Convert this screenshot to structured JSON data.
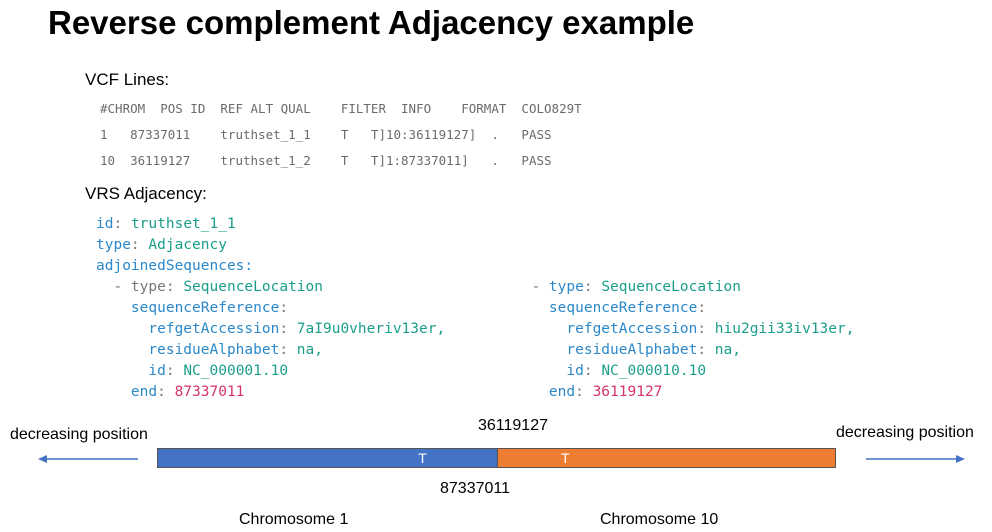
{
  "title": "Reverse complement Adjacency example",
  "vcf": {
    "heading": "VCF Lines:",
    "header": "#CHROM  POS ID  REF ALT QUAL    FILTER  INFO    FORMAT  COLO829T",
    "rows": [
      "1   87337011    truthset_1_1    T   T]10:36119127]  .   PASS",
      "10  36119127    truthset_1_2    T   T]1:87337011]   .   PASS"
    ]
  },
  "vrs": {
    "heading": "VRS Adjacency:",
    "id": "truthset_1_1",
    "type": "Adjacency",
    "adjoined_key": "adjoinedSequences:",
    "sequences": [
      {
        "type": "SequenceLocation",
        "refgetAccession": "7aI9u0vheriv13er,",
        "residueAlphabet": "na,",
        "id": "NC_000001.10",
        "end": "87337011"
      },
      {
        "type": "SequenceLocation",
        "refgetAccession": "hiu2gii33iv13er,",
        "residueAlphabet": "na,",
        "id": "NC_000010.10",
        "end": "36119127"
      }
    ]
  },
  "diagram": {
    "left_label": "decreasing position",
    "right_label": "decreasing position",
    "top_pos": "36119127",
    "bottom_pos": "87337011",
    "base_left": "T",
    "base_right": "T",
    "chrom_left": "Chromosome 1",
    "chrom_right": "Chromosome 10",
    "colors": {
      "chrom1": "#4472c4",
      "chrom10": "#ed7d31"
    }
  }
}
